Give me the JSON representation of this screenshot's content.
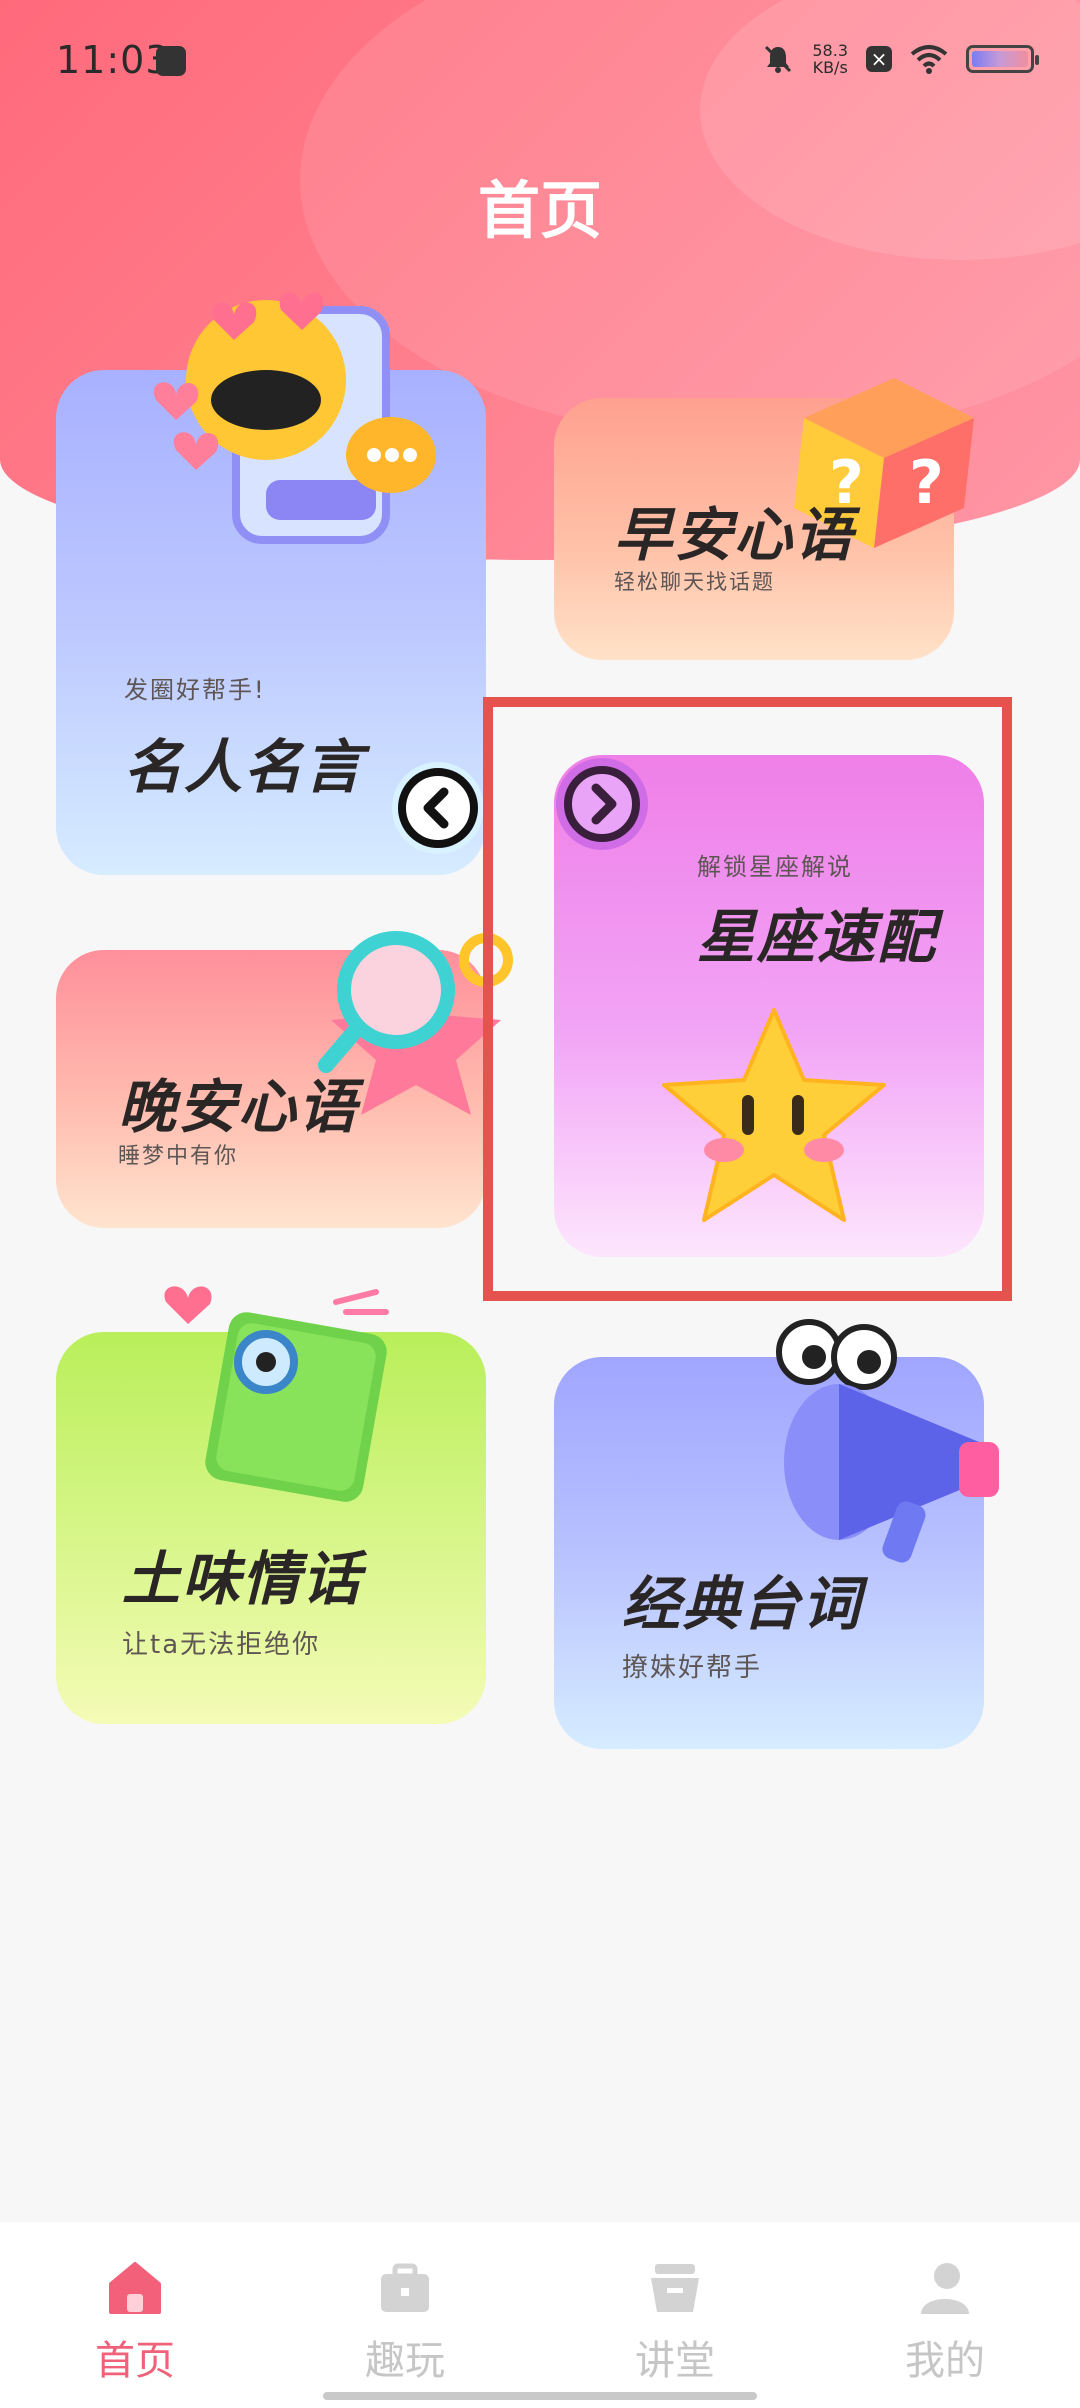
{
  "status_bar": {
    "time": "11:03",
    "speed_value": "58.3",
    "speed_unit": "KB/s",
    "x_glyph": "×"
  },
  "page_title": "首页",
  "cards": {
    "mingren": {
      "sub": "发圈好帮手!",
      "title": "名人名言"
    },
    "zaoan": {
      "title": "早安心语",
      "sub": "轻松聊天找话题"
    },
    "wanan": {
      "title": "晚安心语",
      "sub": "睡梦中有你"
    },
    "xingzuo": {
      "sub": "解锁星座解说",
      "title": "星座速配"
    },
    "tuwei": {
      "title": "土味情话",
      "sub": "让ta无法拒绝你"
    },
    "jingdian": {
      "title": "经典台词",
      "sub": "撩妹好帮手"
    }
  },
  "tabs": [
    {
      "label": "首页",
      "icon": "home-icon",
      "active": true
    },
    {
      "label": "趣玩",
      "icon": "briefcase-icon",
      "active": false
    },
    {
      "label": "讲堂",
      "icon": "basket-icon",
      "active": false
    },
    {
      "label": "我的",
      "icon": "person-icon",
      "active": false
    }
  ],
  "colors": {
    "accent": "#f0627a",
    "highlight_border": "#e5534f",
    "inactive_tab": "#c6c6c6"
  }
}
